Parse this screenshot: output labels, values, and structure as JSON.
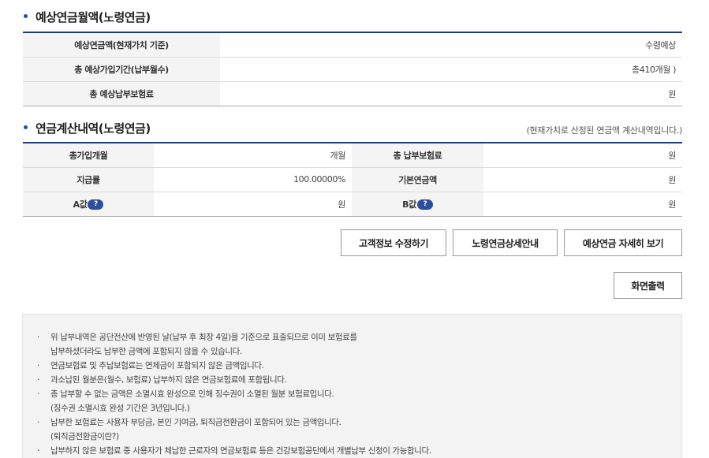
{
  "section1": {
    "title": "예상연금월액(노령연금)",
    "rows": [
      {
        "label": "예상연금액(현재가치 기준)",
        "value": "수령예상"
      },
      {
        "label": "총 예상가입기간(납부월수)",
        "value": "총410개월 )"
      },
      {
        "label": "총 예상납부보험료",
        "value": "원"
      }
    ]
  },
  "section2": {
    "title": "연금계산내역(노령연금)",
    "note": "(현재가치로 산정된 연금액 계산내역입니다.)",
    "rows": [
      {
        "l1": "총가입개월",
        "v1": "개월",
        "l2": "총 납부보험료",
        "v2": "원"
      },
      {
        "l1": "지급률",
        "v1": "100.00000%",
        "l2": "기본연금액",
        "v2": "원"
      },
      {
        "l1": "A값",
        "v1": "원",
        "l2": "B값",
        "v2": "원"
      }
    ],
    "help_glyph": "?"
  },
  "buttons": {
    "edit_customer": "고객정보 수정하기",
    "pension_detail": "노령연금상세안내",
    "view_detail": "예상연금 자세히 보기",
    "print": "화면출력"
  },
  "notices": [
    {
      "bullet": "·",
      "text": "위 납부내역은 공단전산에 반영된 날(납부 후 최장 4일)을 기준으로 표출되므로 이미 보험료를",
      "sub": "납부하셨더라도 납부한 금액에 포함되지 않을 수 있습니다."
    },
    {
      "bullet": "·",
      "text": "연금보험료 및 추납보험료는 연체금이 포함되지 않은 금액입니다.",
      "sub": ""
    },
    {
      "bullet": "·",
      "text": "과소납된 월분은(월수, 보험료) 납부하지 않은 연금보험료에 포함됩니다.",
      "sub": ""
    },
    {
      "bullet": "·",
      "text": "총 납부할 수 없는 금액은 소멸시효 완성으로 인해 징수권이 소멸된 월분 보험료입니다.",
      "sub": "(징수권 소멸시효 완성 기간은 3년입니다.)"
    },
    {
      "bullet": "·",
      "text": "납부한 보험료는 사용자 부담금, 본인 기여금, 퇴직금전환금이 포함되어 있는 금액입니다.",
      "sub": "(퇴직금전환금이란?)"
    },
    {
      "bullet": "·",
      "text": "납부하지 않은 보험료 중 사용자가 체납한 근로자의 연금보험료 등은 건강보험공단에서 개별납부 신청이 가능합니다.",
      "sub": ""
    }
  ]
}
